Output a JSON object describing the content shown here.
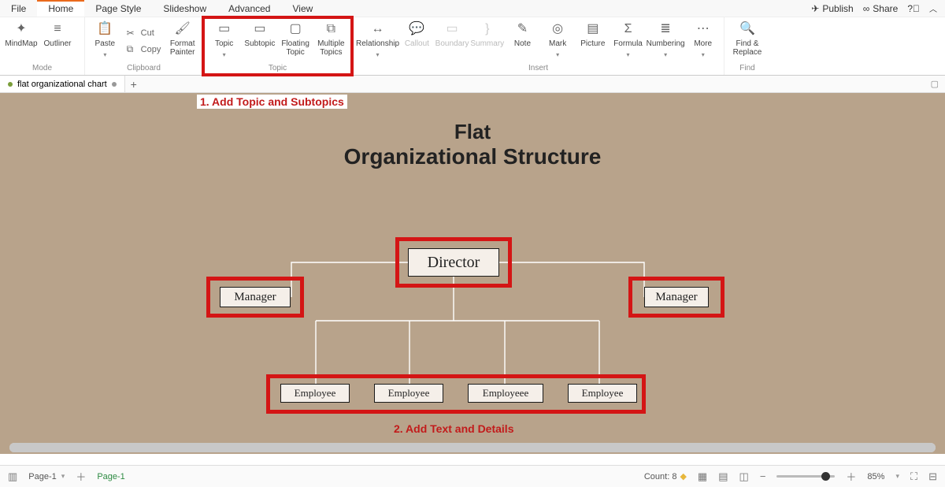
{
  "menu": {
    "items": [
      "File",
      "Home",
      "Page Style",
      "Slideshow",
      "Advanced",
      "View"
    ],
    "activeIndex": 1,
    "right": {
      "publish": "Publish",
      "share": "Share"
    }
  },
  "ribbon": {
    "mode": {
      "label": "Mode",
      "mindmap": "MindMap",
      "outliner": "Outliner"
    },
    "clipboard": {
      "label": "Clipboard",
      "paste": "Paste",
      "cut": "Cut",
      "copy": "Copy",
      "formatPainter": "Format\nPainter"
    },
    "topic": {
      "label": "Topic",
      "topic": "Topic",
      "subtopic": "Subtopic",
      "floating": "Floating\nTopic",
      "multiple": "Multiple\nTopics"
    },
    "insert": {
      "label": "Insert",
      "relationship": "Relationship",
      "callout": "Callout",
      "boundary": "Boundary",
      "summary": "Summary",
      "note": "Note",
      "mark": "Mark",
      "picture": "Picture",
      "formula": "Formula",
      "numbering": "Numbering",
      "more": "More"
    },
    "find": {
      "label": "Find",
      "findReplace": "Find &\nReplace"
    }
  },
  "docTabs": {
    "name": "flat organizational chart"
  },
  "annotations": {
    "a1": "1. Add Topic and Subtopics",
    "a2": "2. Add Text and Details"
  },
  "chart": {
    "title1": "Flat",
    "title2": "Organizational Structure",
    "director": "Director",
    "managerL": "Manager",
    "managerR": "Manager",
    "employees": [
      "Employee",
      "Employee",
      "Employeee",
      "Employee"
    ]
  },
  "status": {
    "pageLabel": "Page-1",
    "pageActive": "Page-1",
    "count": "Count: 8",
    "zoom": "85%"
  }
}
